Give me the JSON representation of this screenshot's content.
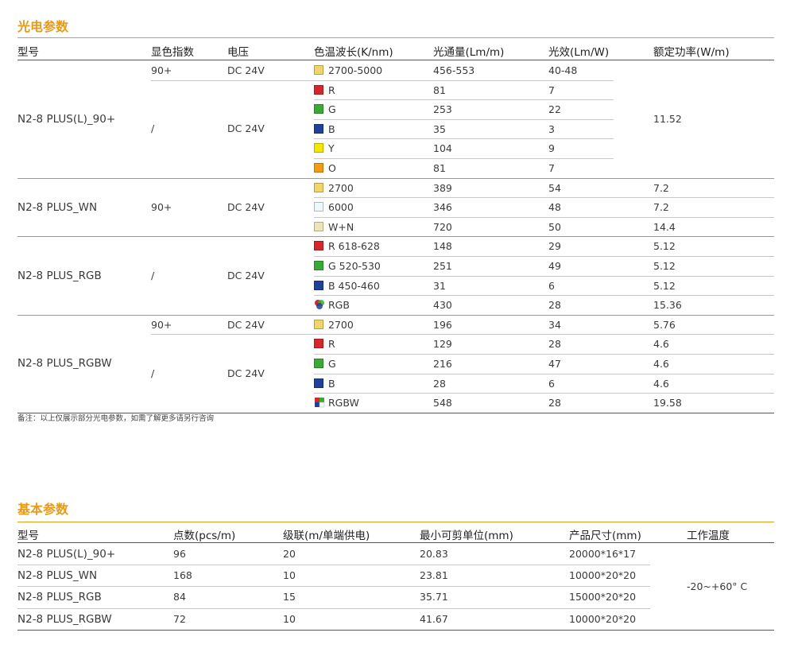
{
  "section1": {
    "title": "光电参数",
    "headers": [
      "型号",
      "显色指数",
      "电压",
      "色温波长(K/nm)",
      "光通量(Lm/m)",
      "光效(Lm/W)",
      "额定功率(W/m)"
    ],
    "groups": [
      {
        "model": "N2-8 PLUS(L)_90+",
        "ra": "/",
        "voltage": "DC 24V",
        "power": "11.52",
        "first_row": {
          "ra": "90+",
          "voltage": "DC 24V"
        },
        "rows": [
          {
            "swatch": "#f2d56a",
            "cct": "2700-5000",
            "flux": "456-553",
            "eff": "40-48"
          },
          {
            "swatch": "#d7262c",
            "cct": "R",
            "flux": "81",
            "eff": "7"
          },
          {
            "swatch": "#3aaa35",
            "cct": "G",
            "flux": "253",
            "eff": "22"
          },
          {
            "swatch": "#20409a",
            "cct": "B",
            "flux": "35",
            "eff": "3"
          },
          {
            "swatch": "#f5e800",
            "cct": "Y",
            "flux": "104",
            "eff": "9"
          },
          {
            "swatch": "#f39c12",
            "cct": "O",
            "flux": "81",
            "eff": "7"
          }
        ]
      },
      {
        "model": "N2-8 PLUS_WN",
        "ra": "90+",
        "voltage": "DC 24V",
        "rows": [
          {
            "swatch": "#f2d56a",
            "cct": "2700",
            "flux": "389",
            "eff": "54",
            "power": "7.2"
          },
          {
            "swatch": "#eef7fb",
            "cct": "6000",
            "flux": "346",
            "eff": "48",
            "power": "7.2"
          },
          {
            "swatch": "#ede5b8",
            "cct": "W+N",
            "flux": "720",
            "eff": "50",
            "power": "14.4"
          }
        ]
      },
      {
        "model": "N2-8 PLUS_RGB",
        "ra": "/",
        "voltage": "DC 24V",
        "rows": [
          {
            "swatch": "#d7262c",
            "cct": "R 618-628",
            "flux": "148",
            "eff": "29",
            "power": "5.12"
          },
          {
            "swatch": "#3aaa35",
            "cct": "G 520-530",
            "flux": "251",
            "eff": "49",
            "power": "5.12"
          },
          {
            "swatch": "#20409a",
            "cct": "B 450-460",
            "flux": "31",
            "eff": "6",
            "power": "5.12"
          },
          {
            "swatch": "rgb-icon",
            "cct": "RGB",
            "flux": "430",
            "eff": "28",
            "power": "15.36"
          }
        ]
      },
      {
        "model": "N2-8 PLUS_RGBW",
        "ra": "/",
        "voltage": "DC 24V",
        "first_row": {
          "ra": "90+",
          "voltage": "DC 24V"
        },
        "rows": [
          {
            "swatch": "#f2d56a",
            "cct": "2700",
            "flux": "196",
            "eff": "34",
            "power": "5.76"
          },
          {
            "swatch": "#d7262c",
            "cct": "R",
            "flux": "129",
            "eff": "28",
            "power": "4.6"
          },
          {
            "swatch": "#3aaa35",
            "cct": "G",
            "flux": "216",
            "eff": "47",
            "power": "4.6"
          },
          {
            "swatch": "#20409a",
            "cct": "B",
            "flux": "28",
            "eff": "6",
            "power": "4.6"
          },
          {
            "swatch": "rgbw-icon",
            "cct": "RGBW",
            "flux": "548",
            "eff": "28",
            "power": "19.58"
          }
        ]
      }
    ],
    "note": "备注：以上仅展示部分光电参数，如需了解更多请另行咨询"
  },
  "section2": {
    "title": "基本参数",
    "headers": [
      "型号",
      "点数(pcs/m)",
      "级联(m/单端供电)",
      "最小可剪单位(mm)",
      "产品尺寸(mm)",
      "工作温度"
    ],
    "rows": [
      {
        "model": "N2-8 PLUS(L)_90+",
        "pcs": "96",
        "cascade": "20",
        "cut": "20.83",
        "size": "20000*16*17"
      },
      {
        "model": "N2-8 PLUS_WN",
        "pcs": "168",
        "cascade": "10",
        "cut": "23.81",
        "size": "10000*20*20"
      },
      {
        "model": "N2-8 PLUS_RGB",
        "pcs": "84",
        "cascade": "15",
        "cut": "35.71",
        "size": "15000*20*20"
      },
      {
        "model": "N2-8 PLUS_RGBW",
        "pcs": "72",
        "cascade": "10",
        "cut": "41.67",
        "size": "10000*20*20"
      }
    ],
    "temp": "-20~+60° C"
  },
  "colors": {
    "accent": "#e69a1a",
    "rule_dark": "#555555",
    "rule_light": "#c8c8c8"
  }
}
